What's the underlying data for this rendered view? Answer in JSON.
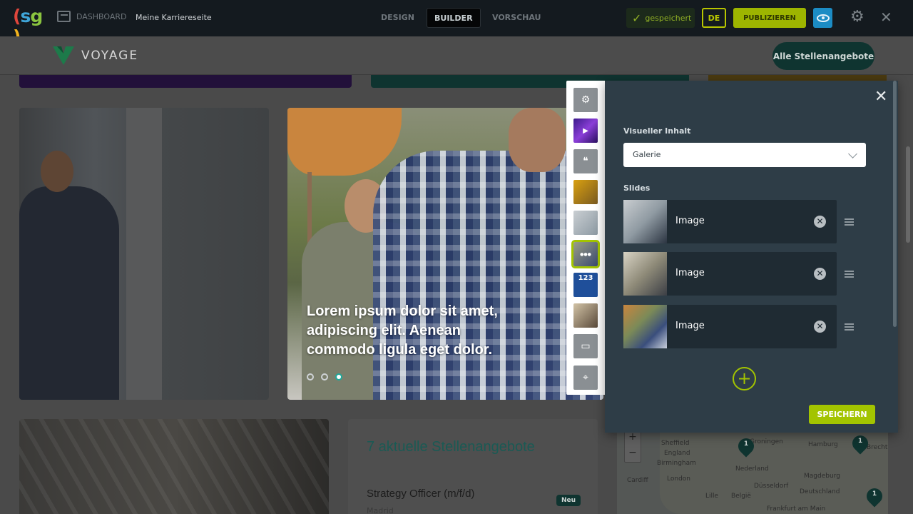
{
  "topbar": {
    "logo_text": "(sg)",
    "dashboard_label": "DASHBOARD",
    "site_name": "Meine Karriereseite",
    "tabs": [
      {
        "label": "DESIGN",
        "active": false
      },
      {
        "label": "BUILDER",
        "active": true
      },
      {
        "label": "VORSCHAU",
        "active": false
      }
    ],
    "saved_label": "gespeichert",
    "language": "DE",
    "publish_label": "PUBLIZIEREN"
  },
  "site_header": {
    "brand": "VOYAGE",
    "all_jobs_label": "Alle Stellenangebote"
  },
  "gallery": {
    "slide_text": "Lorem ipsum dolor sit amet, adipiscing elit. Aenean commodo ligula eget dolor.",
    "active_dot": 2
  },
  "jobs": {
    "title": "7 aktuelle Stellenangebote",
    "items": [
      {
        "title": "Strategy Officer (m/f/d)",
        "location": "Madrid",
        "badge": "Neu"
      }
    ]
  },
  "map": {
    "labels": [
      "Sheffield",
      "England",
      "Birmingham",
      "London",
      "Cardiff",
      "Groningen",
      "Hamburg",
      "Nederland",
      "Magdeburg",
      "Düsseldorf",
      "Deutschland",
      "Lille",
      "België",
      "Frankfurt am Main",
      "Brecht"
    ],
    "pins": [
      "1",
      "1",
      "1"
    ]
  },
  "modules": [
    {
      "icon": "gear-icon",
      "glyph": "⚙"
    },
    {
      "icon": "video-thumb-icon",
      "glyph": ""
    },
    {
      "icon": "quote-icon",
      "glyph": "❝"
    },
    {
      "icon": "image-thumb-icon",
      "glyph": ""
    },
    {
      "icon": "image-thumb-icon",
      "glyph": ""
    },
    {
      "icon": "gallery-thumb-icon",
      "glyph": ""
    },
    {
      "icon": "counter-thumb-icon",
      "glyph": "123"
    },
    {
      "icon": "image-thumb-icon",
      "glyph": ""
    },
    {
      "icon": "jobs-icon",
      "glyph": "▭"
    },
    {
      "icon": "location-icon",
      "glyph": "⌖"
    }
  ],
  "panel": {
    "visual_content_label": "Visueller Inhalt",
    "visual_content_value": "Galerie",
    "slides_label": "Slides",
    "slides": [
      {
        "label": "Image"
      },
      {
        "label": "Image"
      },
      {
        "label": "Image"
      }
    ],
    "save_label": "SPEICHERN"
  },
  "colors": {
    "accent": "#a3c400",
    "panel_bg": "#2e3d47",
    "brand_teal": "#0f3430"
  }
}
